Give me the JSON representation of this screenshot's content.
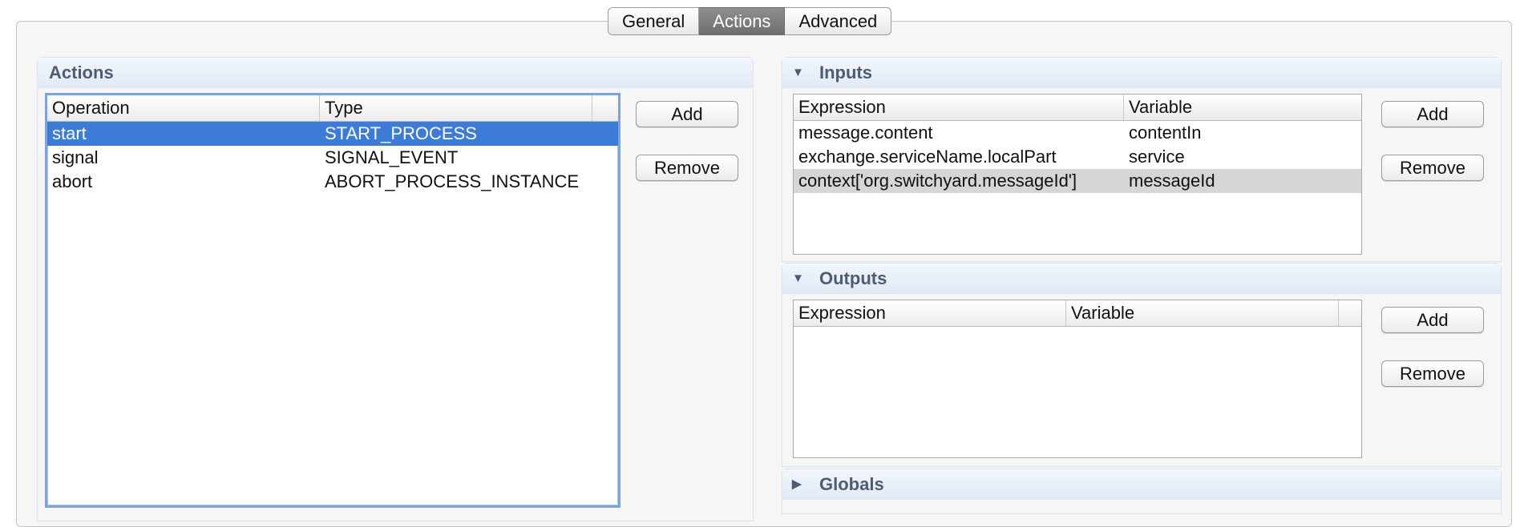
{
  "tabs": [
    {
      "label": "General",
      "active": false
    },
    {
      "label": "Actions",
      "active": true
    },
    {
      "label": "Advanced",
      "active": false
    }
  ],
  "actions": {
    "title": "Actions",
    "columns": [
      "Operation",
      "Type"
    ],
    "rows": [
      {
        "operation": "start",
        "type": "START_PROCESS",
        "selected": true
      },
      {
        "operation": "signal",
        "type": "SIGNAL_EVENT",
        "selected": false
      },
      {
        "operation": "abort",
        "type": "ABORT_PROCESS_INSTANCE",
        "selected": false
      }
    ],
    "add_label": "Add",
    "remove_label": "Remove"
  },
  "inputs": {
    "title": "Inputs",
    "expanded": true,
    "columns": [
      "Expression",
      "Variable"
    ],
    "rows": [
      {
        "expression": "message.content",
        "variable": "contentIn"
      },
      {
        "expression": "exchange.serviceName.localPart",
        "variable": "service"
      },
      {
        "expression": "context['org.switchyard.messageId']",
        "variable": "messageId",
        "highlighted": true
      }
    ],
    "add_label": "Add",
    "remove_label": "Remove"
  },
  "outputs": {
    "title": "Outputs",
    "expanded": true,
    "columns": [
      "Expression",
      "Variable"
    ],
    "rows": [],
    "add_label": "Add",
    "remove_label": "Remove"
  },
  "globals": {
    "title": "Globals",
    "expanded": false
  },
  "colors": {
    "selection": "#3d7bd9",
    "highlight_row": "#d6d6d6",
    "section_title": "#4d5b73",
    "active_tab": "#7a7a7a"
  }
}
